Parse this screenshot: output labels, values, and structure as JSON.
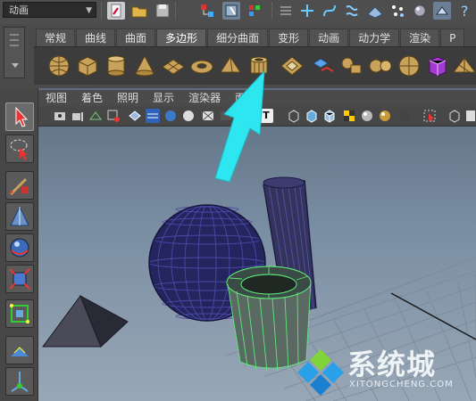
{
  "top_bar": {
    "menu_set": "动画",
    "menu_set_icons": [
      "new-scene-icon",
      "open-scene-icon",
      "save-scene-icon",
      "select-hierarchy-icon",
      "select-object-icon",
      "select-component-icon",
      "snap-grid-icon",
      "snap-curve-icon",
      "snap-point-icon",
      "snap-plane-icon",
      "make-live-icon",
      "history-icon",
      "render-icon",
      "help-icon"
    ]
  },
  "shelf": {
    "tabs": [
      "常规",
      "曲线",
      "曲面",
      "多边形",
      "细分曲面",
      "变形",
      "动画",
      "动力学",
      "渲染",
      "P"
    ],
    "active_tab": "多边形",
    "items": [
      {
        "name": "poly-sphere-icon"
      },
      {
        "name": "poly-cube-icon"
      },
      {
        "name": "poly-cylinder-icon"
      },
      {
        "name": "poly-cone-icon"
      },
      {
        "name": "poly-plane-icon"
      },
      {
        "name": "poly-torus-icon"
      },
      {
        "name": "poly-pyramid-icon"
      },
      {
        "name": "poly-pipe-icon"
      },
      {
        "name": "combine-icon"
      },
      {
        "name": "separate-icon"
      },
      {
        "name": "extract-icon"
      },
      {
        "name": "smooth-icon"
      },
      {
        "name": "mirror-icon"
      },
      {
        "name": "bevel-icon"
      }
    ]
  },
  "viewport": {
    "menu": [
      "视图",
      "着色",
      "照明",
      "显示",
      "渲染器",
      "面"
    ],
    "text_toggle": "T"
  },
  "toolbox": {
    "tools": [
      "select-tool-icon",
      "lasso-tool-icon",
      "paint-select-tool-icon",
      "move-tool-icon",
      "rotate-tool-icon",
      "scale-tool-icon",
      "universal-manipulator-icon",
      "soft-mod-icon",
      "show-manipulator-icon"
    ]
  },
  "scene": {
    "objects": [
      "poly-sphere",
      "poly-cylinder",
      "poly-pipe",
      "poly-pyramid",
      "grid"
    ],
    "selected_object": "poly-pipe",
    "pipe_wire_color": "#5ee87a",
    "wire_color": "#1c1c6b"
  },
  "annotation": {
    "arrow_color": "#2ee6f0"
  },
  "watermark": {
    "text": "系统城",
    "subtext": "XITONGCHENG.COM"
  }
}
